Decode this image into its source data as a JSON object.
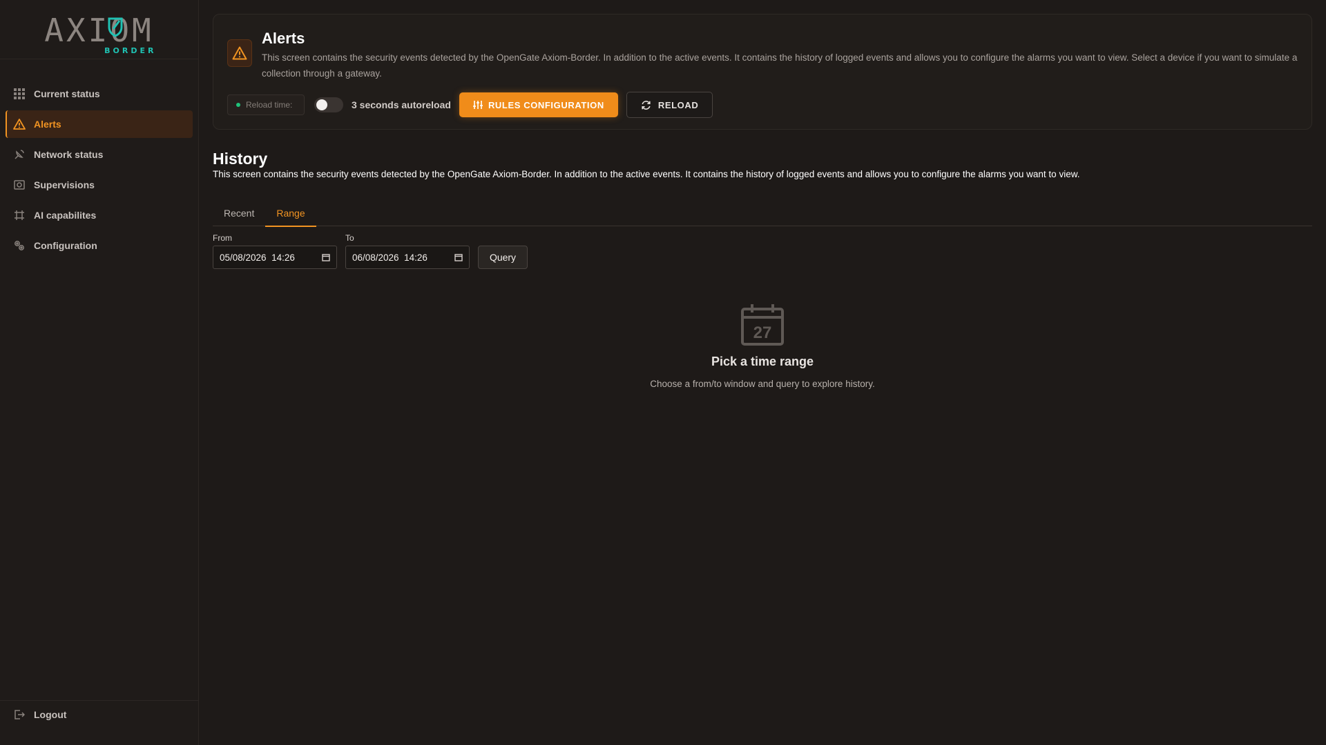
{
  "brand": {
    "word": "AXIOM",
    "sub": "BORDER",
    "accent": "#1fc2b3"
  },
  "sidebar": {
    "items": [
      {
        "label": "Current status",
        "icon": "grid-icon"
      },
      {
        "label": "Alerts",
        "icon": "warning-triangle-icon",
        "active": true
      },
      {
        "label": "Network status",
        "icon": "satellite-dish-icon"
      },
      {
        "label": "Supervisions",
        "icon": "camera-box-icon"
      },
      {
        "label": "AI capabilites",
        "icon": "ai-chip-icon"
      },
      {
        "label": "Configuration",
        "icon": "gears-icon"
      }
    ],
    "logout": {
      "label": "Logout",
      "icon": "logout-icon"
    }
  },
  "alerts_card": {
    "title": "Alerts",
    "description": "This screen contains the security events detected by the OpenGate Axiom-Border. In addition to the active events. It contains the history of logged events and allows you to configure the alarms you want to view. Select a device if you want to simulate a collection through a gateway.",
    "reload_time_label": "Reload time:",
    "autoreload_label": "3 seconds autoreload",
    "autoreload_on": false,
    "rules_button": "RULES CONFIGURATION",
    "reload_button": "RELOAD"
  },
  "history": {
    "title": "History",
    "description": "This screen contains the security events detected by the OpenGate Axiom-Border. In addition to the active events. It contains the history of logged events and allows you to configure the alarms you want to view.",
    "tabs": [
      {
        "label": "Recent",
        "active": false
      },
      {
        "label": "Range",
        "active": true
      }
    ],
    "range": {
      "from_label": "From",
      "from_value": "05/08/2026  14:26",
      "to_label": "To",
      "to_value": "06/08/2026  14:26",
      "query_button": "Query"
    },
    "empty_state": {
      "icon": "calendar-icon",
      "icon_day": "27",
      "title": "Pick a time range",
      "subtitle": "Choose a from/to window and query to explore history."
    }
  },
  "colors": {
    "background": "#1e1a18",
    "accent": "#f29422",
    "button_primary": "#f08c1a",
    "status_dot": "#1fc27a"
  }
}
